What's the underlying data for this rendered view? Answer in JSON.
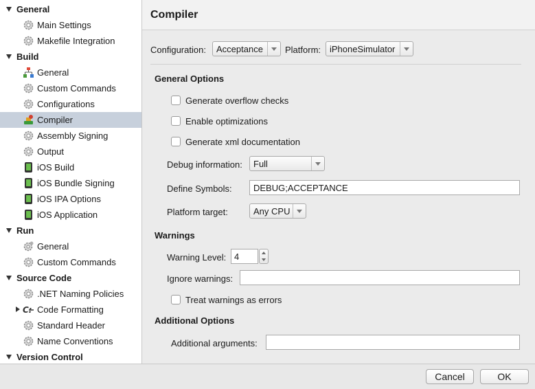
{
  "sidebar": {
    "groups": [
      {
        "label": "General",
        "items": [
          {
            "label": "Main Settings",
            "icon": "gear-icon"
          },
          {
            "label": "Makefile Integration",
            "icon": "gear-icon"
          }
        ]
      },
      {
        "label": "Build",
        "items": [
          {
            "label": "General",
            "icon": "build-tree-icon"
          },
          {
            "label": "Custom Commands",
            "icon": "gear-icon"
          },
          {
            "label": "Configurations",
            "icon": "gear-icon"
          },
          {
            "label": "Compiler",
            "icon": "compiler-icon",
            "selected": true
          },
          {
            "label": "Assembly Signing",
            "icon": "gear-icon"
          },
          {
            "label": "Output",
            "icon": "gear-icon"
          },
          {
            "label": "iOS Build",
            "icon": "ios-device-icon"
          },
          {
            "label": "iOS Bundle Signing",
            "icon": "ios-device-icon"
          },
          {
            "label": "iOS IPA Options",
            "icon": "ios-device-icon"
          },
          {
            "label": "iOS Application",
            "icon": "ios-device-icon"
          }
        ]
      },
      {
        "label": "Run",
        "items": [
          {
            "label": "General",
            "icon": "run-gear-icon"
          },
          {
            "label": "Custom Commands",
            "icon": "gear-icon"
          }
        ]
      },
      {
        "label": "Source Code",
        "items": [
          {
            "label": ".NET Naming Policies",
            "icon": "gear-icon"
          },
          {
            "label": "Code Formatting",
            "icon": "code-formatting-icon",
            "collapsed": true
          },
          {
            "label": "Standard Header",
            "icon": "gear-icon"
          },
          {
            "label": "Name Conventions",
            "icon": "gear-icon"
          }
        ]
      },
      {
        "label": "Version Control",
        "items": []
      }
    ]
  },
  "main": {
    "title": "Compiler",
    "configuration_label": "Configuration:",
    "configuration_value": "Acceptance",
    "platform_label": "Platform:",
    "platform_value": "iPhoneSimulator",
    "general_options": {
      "heading": "General Options",
      "overflow_checks": "Generate overflow checks",
      "optimizations": "Enable optimizations",
      "xml_doc": "Generate xml documentation",
      "debug_info_label": "Debug information:",
      "debug_info_value": "Full",
      "define_symbols_label": "Define Symbols:",
      "define_symbols_value": "DEBUG;ACCEPTANCE",
      "platform_target_label": "Platform target:",
      "platform_target_value": "Any CPU"
    },
    "warnings": {
      "heading": "Warnings",
      "level_label": "Warning Level:",
      "level_value": "4",
      "ignore_label": "Ignore warnings:",
      "ignore_value": "",
      "as_errors": "Treat warnings as errors"
    },
    "additional": {
      "heading": "Additional Options",
      "args_label": "Additional arguments:",
      "args_value": ""
    }
  },
  "footer": {
    "cancel_label": "Cancel",
    "ok_label": "OK"
  }
}
